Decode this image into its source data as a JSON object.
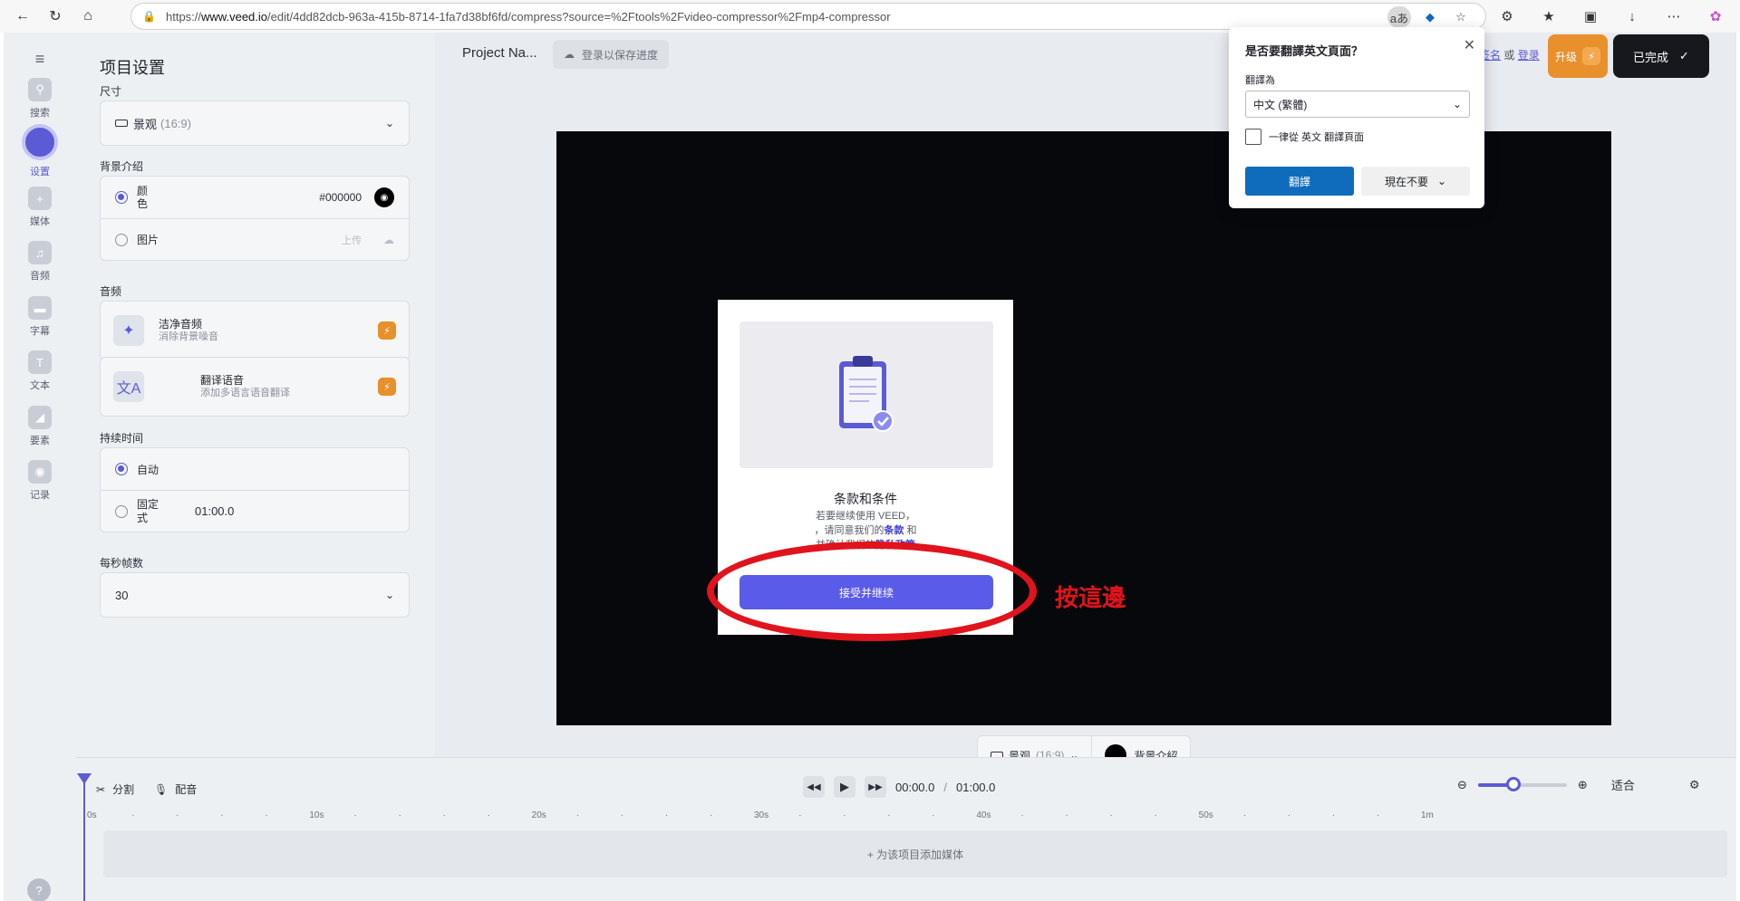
{
  "browser": {
    "url_prefix": "https://",
    "url_host": "www.veed.io",
    "url_rest": "/edit/4dd82dcb-963a-415b-8714-1fa7d38bf6fd/compress?source=%2Ftools%2Fvideo-compressor%2Fmp4-compressor",
    "translate_badge": "aあ"
  },
  "rail": {
    "items": [
      {
        "label": "搜索",
        "icon": "search-icon"
      },
      {
        "label": "设置",
        "icon": "settings-icon"
      },
      {
        "label": "媒体",
        "icon": "plus-icon"
      },
      {
        "label": "音频",
        "icon": "music-icon"
      },
      {
        "label": "字幕",
        "icon": "subtitles-icon"
      },
      {
        "label": "文本",
        "icon": "text-icon"
      },
      {
        "label": "要素",
        "icon": "elements-icon"
      },
      {
        "label": "记录",
        "icon": "record-icon"
      }
    ],
    "help": "?"
  },
  "panel": {
    "title": "项目设置",
    "size_label": "尺寸",
    "size_value": "景观",
    "size_ratio": "(16:9)",
    "bg_label": "背景介绍",
    "bg_color_label": "颜色",
    "bg_color_hex": "#000000",
    "bg_image_label": "图片",
    "bg_upload": "上传",
    "audio_label": "音频",
    "clean_audio_title": "洁净音频",
    "clean_audio_sub": "消除背景噪音",
    "translate_title": "翻译语音",
    "translate_sub": "添加多语言语音翻译",
    "duration_label": "持续时间",
    "duration_auto": "自动",
    "duration_fixed": "固定式",
    "duration_value": "01:00.0",
    "fps_label": "每秒帧数",
    "fps_value": "30"
  },
  "topbar": {
    "project_name": "Project Na...",
    "save_label": "登录以保存进度",
    "link1": "签名",
    "or": "或",
    "link2": "登录",
    "upgrade": "升级",
    "done": "已完成"
  },
  "modal": {
    "title": "条款和条件",
    "line1": "若要继续使用 VEED，",
    "line2a": "，请同意我们的",
    "terms": "条款",
    "line2b": "和",
    "line3a": "并确认我们的",
    "privacy": "隐私政策",
    "accept": "接受并继续"
  },
  "annotation": {
    "text": "按這邊",
    "color": "#e0141c"
  },
  "canvas_controls": {
    "ratio_label": "景观",
    "ratio_value": "(16:9)",
    "bg_label": "背景介紹"
  },
  "timeline": {
    "split": "分割",
    "voice": "配音",
    "current_time": "00:00.0",
    "separator": "/",
    "total_time": "01:00.0",
    "fit": "适合",
    "zoom_level": 0.4,
    "ruler": [
      "0s",
      "10s",
      "20s",
      "30s",
      "40s",
      "50s",
      "1m"
    ],
    "add_media": "+ 为该项目添加媒体"
  },
  "translate_popup": {
    "title": "是否要翻譯英文頁面？",
    "translate_to": "翻譯為",
    "language": "中文 (繁體)",
    "always": "一律從 英文 翻譯頁面",
    "translate_btn": "翻譯",
    "not_now": "現在不要"
  },
  "colors": {
    "accent": "#5b5bd6",
    "upgrade": "#e8902c",
    "edge_blue": "#0f6cbd"
  }
}
